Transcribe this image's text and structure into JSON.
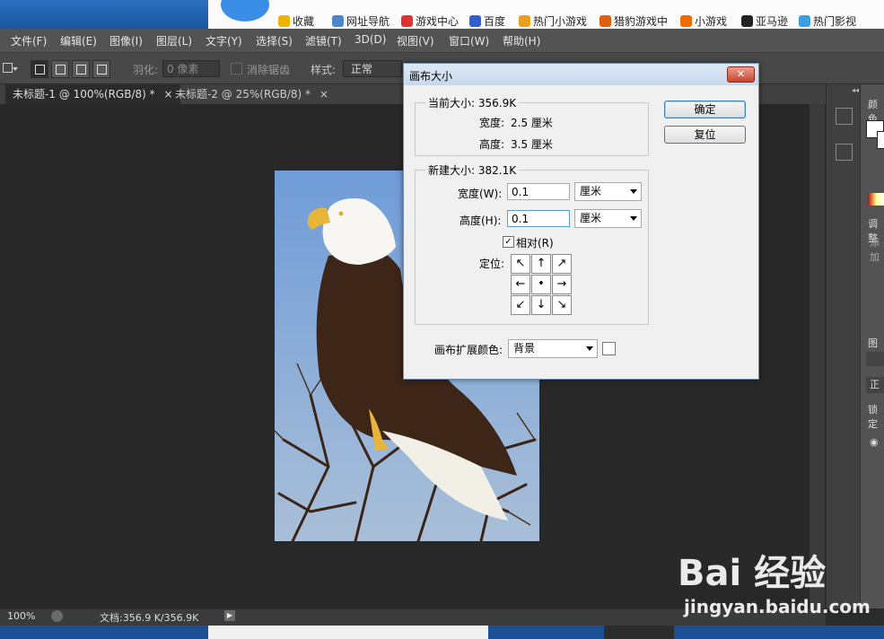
{
  "browser": {
    "bookmarks": [
      {
        "label": "收藏",
        "color": "#f0b400"
      },
      {
        "label": "网址导航",
        "color": "#4a86c8"
      },
      {
        "label": "游戏中心",
        "color": "#d33"
      },
      {
        "label": "百度",
        "color": "#2f5fd0"
      },
      {
        "label": "热门小游戏",
        "color": "#e8a020"
      },
      {
        "label": "猎豹游戏中",
        "color": "#e06010"
      },
      {
        "label": "小游戏",
        "color": "#f06a00"
      },
      {
        "label": "亚马逊",
        "color": "#222"
      },
      {
        "label": "热门影视",
        "color": "#3aa0e0"
      }
    ]
  },
  "menubar": {
    "items": [
      "文件(F)",
      "编辑(E)",
      "图像(I)",
      "图层(L)",
      "文字(Y)",
      "选择(S)",
      "滤镜(T)",
      "3D(D)",
      "视图(V)",
      "窗口(W)",
      "帮助(H)"
    ]
  },
  "options": {
    "feather_label": "羽化:",
    "feather_value": "0 像素",
    "antialias_label": "消除锯齿",
    "style_label": "样式:",
    "style_value": "正常"
  },
  "tabs": [
    {
      "label": "未标题-1 @ 100%(RGB/8) *",
      "close": "×"
    },
    {
      "label": "未标题-2 @ 25%(RGB/8) *",
      "close": "×"
    }
  ],
  "status": {
    "zoom": "100%",
    "doc": "文档:356.9 K/356.9K"
  },
  "right_panel": {
    "color_tab": "颜色",
    "adjust_tab": "调整",
    "adjust_add": "添加",
    "layers_tab": "图层",
    "blend": "正",
    "lock": "锁定"
  },
  "dialog": {
    "title": "画布大小",
    "close": "✕",
    "current": {
      "legend": "当前大小: 356.9K",
      "width_label": "宽度:",
      "width_value": "2.5 厘米",
      "height_label": "高度:",
      "height_value": "3.5 厘米"
    },
    "new": {
      "legend": "新建大小: 382.1K",
      "width_label": "宽度(W):",
      "width_value": "0.1",
      "width_unit": "厘米",
      "height_label": "高度(H):",
      "height_value": "0.1",
      "height_unit": "厘米",
      "relative_label": "相对(R)",
      "relative_checked": true,
      "anchor_label": "定位:",
      "anchor": [
        "↖",
        "↑",
        "↗",
        "←",
        "•",
        "→",
        "↙",
        "↓",
        "↘"
      ]
    },
    "ext_color_label": "画布扩展颜色:",
    "ext_color_value": "背景",
    "ok": "确定",
    "reset": "复位"
  },
  "watermark": {
    "brand": "Bai 经验",
    "url": "jingyan.baidu.com"
  }
}
